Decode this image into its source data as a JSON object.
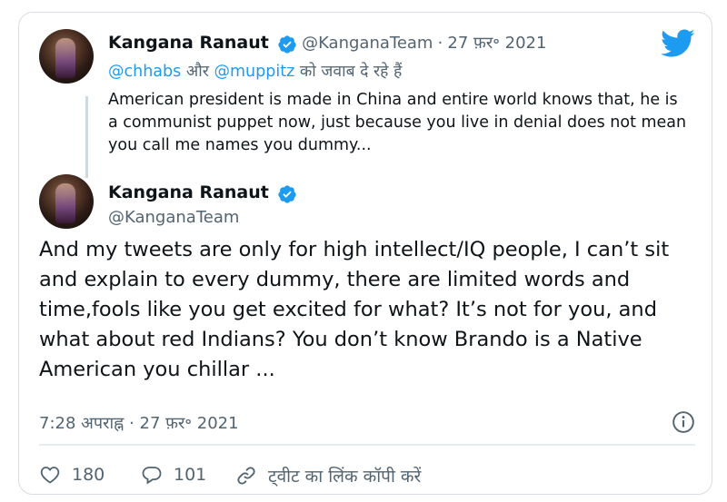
{
  "reply": {
    "name": "Kangana Ranaut",
    "handle": "@KanganaTeam",
    "separator": "·",
    "date": "27 फ़र॰ 2021",
    "replying_handle_1": "@chhabs",
    "replying_connector": "और",
    "replying_handle_2": "@muppitz",
    "replying_suffix": "को जवाब दे रहे हैं",
    "text": "American president is made in China and entire world knows that, he is a communist puppet now, just because you live in denial does not mean you call me names you dummy..."
  },
  "main": {
    "name": "Kangana Ranaut",
    "handle": "@KanganaTeam",
    "text": "And my tweets are only for high intellect/IQ people, I can’t sit and explain to every dummy, there are limited words and time,fools like you get excited for what? It’s not for you, and what about red Indians? You don’t know Brando is a Native American you chillar ...",
    "timestamp": "7:28 अपराह्न · 27 फ़र॰ 2021"
  },
  "actions": {
    "likes": "180",
    "replies": "101",
    "copy_link": "ट्वीट का लिंक कॉपी करें"
  },
  "icons": {
    "logo": "twitter-bird-icon",
    "verified": "verified-badge-icon",
    "info": "info-icon",
    "like": "heart-icon",
    "reply": "reply-bubble-icon",
    "link": "link-icon"
  },
  "colors": {
    "brand": "#1d9bf0",
    "text": "#0f1419",
    "muted": "#536471"
  }
}
